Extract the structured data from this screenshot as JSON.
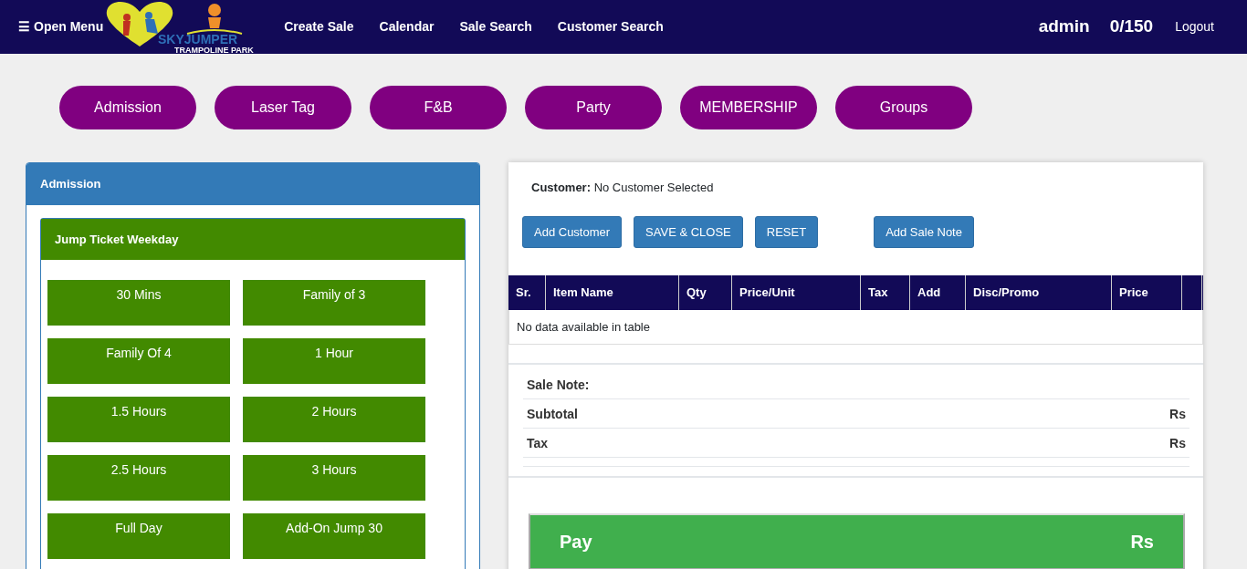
{
  "navbar": {
    "menu_icon": "☰",
    "menu_label": "Open Menu",
    "logo": {
      "name": "SKYJUMPER",
      "tagline": "TRAMPOLINE PARK"
    },
    "links": [
      "Create Sale",
      "Calendar",
      "Sale Search",
      "Customer Search"
    ],
    "user": "admin",
    "count": "0/150",
    "logout": "Logout"
  },
  "categories": [
    "Admission",
    "Laser Tag",
    "F&B",
    "Party",
    "MEMBERSHIP",
    "Groups"
  ],
  "products_panel": {
    "title": "Admission",
    "group": {
      "title": "Jump Ticket Weekday",
      "items": [
        "30 Mins",
        "Family of 3",
        "Family Of 4",
        "1 Hour",
        "1.5 Hours",
        "2 Hours",
        "2.5 Hours",
        "3 Hours",
        "Full Day",
        "Add-On Jump 30"
      ]
    }
  },
  "sale": {
    "customer_label": "Customer:",
    "customer_value": "No Customer Selected",
    "buttons": [
      "Add Customer",
      "SAVE & CLOSE",
      "RESET",
      "Add Sale Note"
    ],
    "table": {
      "columns": [
        "Sr.",
        "Item Name",
        "Qty",
        "Price/Unit",
        "Tax",
        "Add",
        "Disc/Promo",
        "Price"
      ],
      "empty_message": "No data available in table"
    },
    "summary": [
      {
        "label": "Sale Note:"
      },
      {
        "label": "Subtotal",
        "value": "Rs"
      },
      {
        "label": "Tax",
        "value": "Rs"
      }
    ],
    "pay": {
      "label": "Pay",
      "value": "Rs"
    }
  }
}
